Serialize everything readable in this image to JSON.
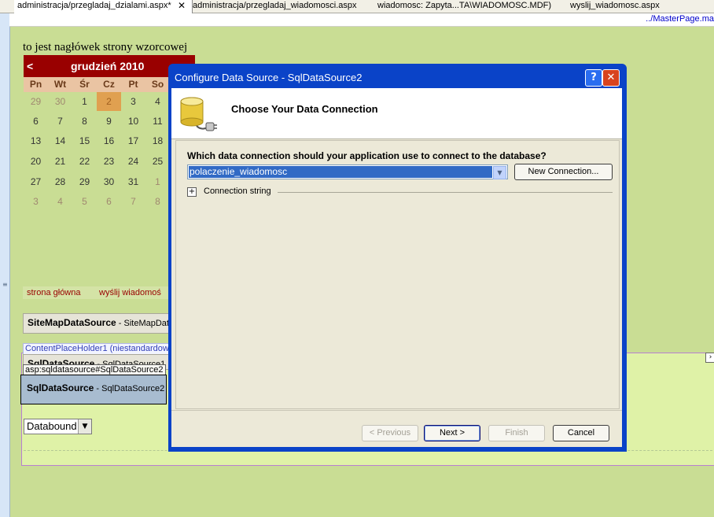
{
  "tabs": [
    {
      "label": "administracja/przegladaj_dzialami.aspx*",
      "active": true
    },
    {
      "label": "administracja/przegladaj_wiadomosci.aspx",
      "active": false
    },
    {
      "label": "wiadomosc: Zapyta...TA\\WIADOMOSC.MDF)",
      "active": false
    },
    {
      "label": "wyslij_wiadomosc.aspx",
      "active": false
    }
  ],
  "tab_close_glyph": "✕",
  "path": "../MasterPage.ma",
  "page_header": "to jest nagłówek strony wzorcowej",
  "calendar": {
    "prev": "<",
    "month": "grudzień 2010",
    "days_of_week": [
      "Pn",
      "Wt",
      "Śr",
      "Cz",
      "Pt",
      "So"
    ],
    "weeks": [
      [
        "29",
        "30",
        "1",
        "2",
        "3",
        "4"
      ],
      [
        "6",
        "7",
        "8",
        "9",
        "10",
        "11"
      ],
      [
        "13",
        "14",
        "15",
        "16",
        "17",
        "18"
      ],
      [
        "20",
        "21",
        "22",
        "23",
        "24",
        "25"
      ],
      [
        "27",
        "28",
        "29",
        "30",
        "31",
        "1"
      ],
      [
        "3",
        "4",
        "5",
        "6",
        "7",
        "8"
      ]
    ],
    "selected": "2"
  },
  "nav_menu": [
    "strona główna",
    "wyślij wiadomoś"
  ],
  "sitemap_control": {
    "type": "SiteMapDataSource",
    "id": "SiteMapData"
  },
  "content_placeholder_label": "ContentPlaceHolder1 (niestandardow",
  "sql_control_1": {
    "type": "SqlDataSource",
    "id": "SqlDataSource1"
  },
  "tag_label": "asp:sqldatasource#SqlDataSource2",
  "sql_control_2": {
    "type": "SqlDataSource",
    "id": "SqlDataSource2"
  },
  "dropdown": {
    "value": "Databound"
  },
  "dialog": {
    "title": "Configure Data Source - SqlDataSource2",
    "help_glyph": "?",
    "close_glyph": "✕",
    "banner": "Choose Your Data Connection",
    "question": "Which data connection should your application use to connect to the database?",
    "connection_value": "polaczenie_wiadomosc",
    "new_connection_label": "New Connection...",
    "expander_glyph": "+",
    "connection_string_label": "Connection string",
    "buttons": {
      "previous": "< Previous",
      "next": "Next >",
      "finish": "Finish",
      "cancel": "Cancel"
    }
  },
  "colors": {
    "design_bg": "#c9dd94",
    "calendar_title": "#990000",
    "dialog_titlebar": "#0a43c8",
    "selection": "#316ac5"
  }
}
